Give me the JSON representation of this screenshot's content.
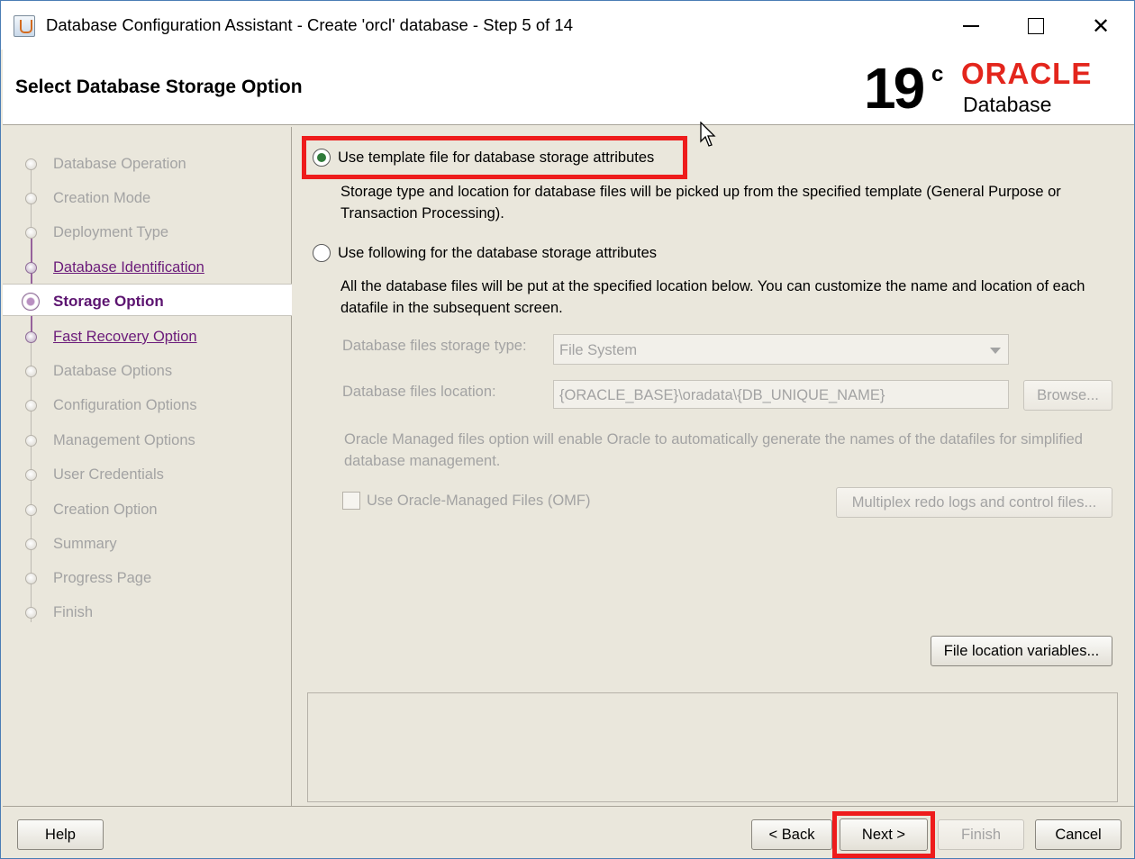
{
  "window": {
    "title": "Database Configuration Assistant - Create 'orcl' database - Step 5 of 14",
    "close_glyph": "✕"
  },
  "header": {
    "page_title": "Select Database Storage Option",
    "logo_version": "19",
    "logo_superscript": "c",
    "logo_brand": "ORACLE",
    "logo_product": "Database"
  },
  "nav": {
    "items": [
      {
        "label": "Database Operation",
        "state": "disabled"
      },
      {
        "label": "Creation Mode",
        "state": "disabled"
      },
      {
        "label": "Deployment Type",
        "state": "disabled"
      },
      {
        "label": "Database Identification",
        "state": "link"
      },
      {
        "label": "Storage Option",
        "state": "current"
      },
      {
        "label": "Fast Recovery Option",
        "state": "link"
      },
      {
        "label": "Database Options",
        "state": "disabled"
      },
      {
        "label": "Configuration Options",
        "state": "disabled"
      },
      {
        "label": "Management Options",
        "state": "disabled"
      },
      {
        "label": "User Credentials",
        "state": "disabled"
      },
      {
        "label": "Creation Option",
        "state": "disabled"
      },
      {
        "label": "Summary",
        "state": "disabled"
      },
      {
        "label": "Progress Page",
        "state": "disabled"
      },
      {
        "label": "Finish",
        "state": "disabled"
      }
    ]
  },
  "content": {
    "option_template_label": "Use template file for database storage attributes",
    "option_template_desc": "Storage type and location for database files will be picked up from the specified template (General Purpose or Transaction Processing).",
    "option_following_label": "Use following for the database storage attributes",
    "option_following_desc": "All the database files will be put at the specified location below. You can customize the name and location of each datafile in the subsequent screen.",
    "storage_type_label": "Database files storage type:",
    "storage_type_value": "File System",
    "location_label": "Database files location:",
    "location_value": "{ORACLE_BASE}\\oradata\\{DB_UNIQUE_NAME}",
    "browse_label": "Browse...",
    "omf_desc": "Oracle Managed files option will enable Oracle to automatically generate the names of the datafiles for simplified database management.",
    "omf_label": "Use Oracle-Managed Files (OMF)",
    "multiplex_label": "Multiplex redo logs and control files...",
    "file_location_vars_label": "File location variables..."
  },
  "footer": {
    "help_label": "Help",
    "back_label": "< Back",
    "next_label": "Next >",
    "finish_label": "Finish",
    "cancel_label": "Cancel"
  },
  "colors": {
    "highlight": "#ee1c1c",
    "oracle_red": "#e3251c",
    "nav_link": "#6b1b7a"
  }
}
